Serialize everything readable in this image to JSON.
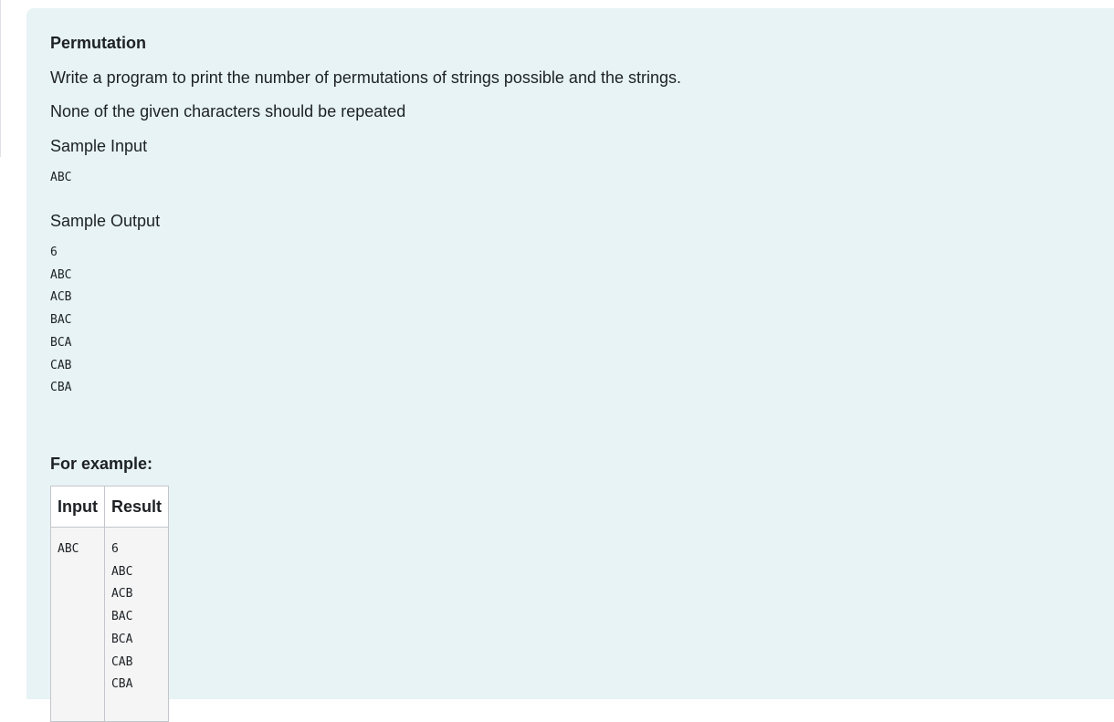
{
  "question": {
    "title": "Permutation",
    "description": "Write a program to print the number of permutations of strings possible and the strings.",
    "constraint": "None of the given characters should be repeated",
    "sample_input_label": "Sample Input",
    "sample_input": "ABC",
    "sample_output_label": "Sample Output",
    "sample_output": "6\nABC\nACB\nBAC\nBCA\nCAB\nCBA"
  },
  "examples": {
    "label": "For example:",
    "headers": {
      "input": "Input",
      "result": "Result"
    },
    "rows": [
      {
        "input": "ABC",
        "result": "6\nABC\nACB\nBAC\nBCA\nCAB\nCBA"
      }
    ]
  }
}
